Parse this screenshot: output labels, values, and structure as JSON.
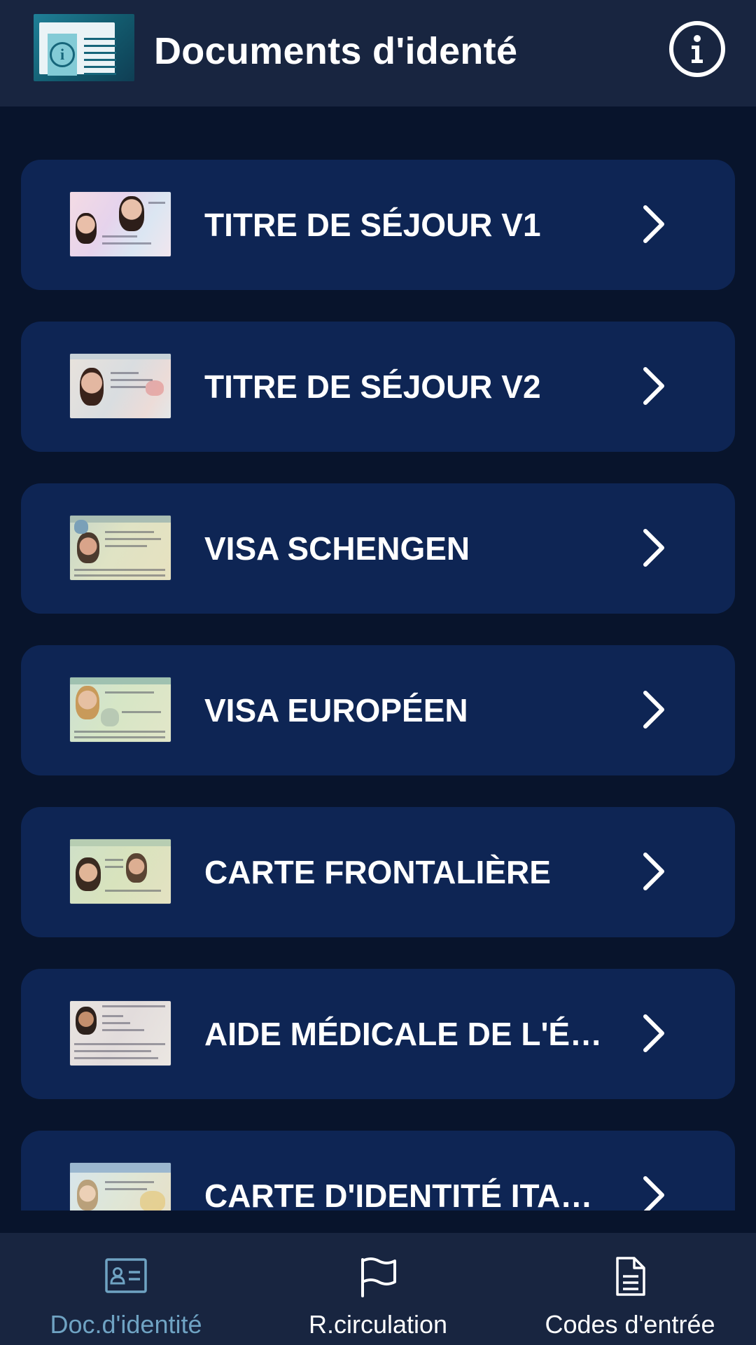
{
  "header": {
    "title": "Documents d'identé",
    "logo_icon": "id-card-info-icon",
    "info_icon": "info-circle-icon"
  },
  "documents": [
    {
      "label": "TITRE DE SÉJOUR V1",
      "thumbnail": "residence-permit-v1-thumbnail"
    },
    {
      "label": "TITRE DE SÉJOUR V2",
      "thumbnail": "residence-permit-v2-thumbnail"
    },
    {
      "label": "VISA SCHENGEN",
      "thumbnail": "schengen-visa-thumbnail"
    },
    {
      "label": "VISA EUROPÉEN",
      "thumbnail": "european-visa-thumbnail"
    },
    {
      "label": "CARTE FRONTALIÈRE",
      "thumbnail": "border-card-thumbnail"
    },
    {
      "label": "AIDE MÉDICALE DE L'ÉT...",
      "thumbnail": "state-medical-aid-thumbnail"
    },
    {
      "label": "CARTE D'IDENTITÉ ITALI...",
      "thumbnail": "italian-id-card-thumbnail"
    }
  ],
  "bottom_nav": [
    {
      "label": "Doc.d'identité",
      "icon": "id-card-icon",
      "active": true
    },
    {
      "label": "R.circulation",
      "icon": "flag-icon",
      "active": false
    },
    {
      "label": "Codes d'entrée",
      "icon": "document-icon",
      "active": false
    }
  ],
  "colors": {
    "background": "#08142c",
    "header": "#182540",
    "card": "#0e2554",
    "active_nav": "#6fa3c3",
    "text": "#ffffff"
  }
}
